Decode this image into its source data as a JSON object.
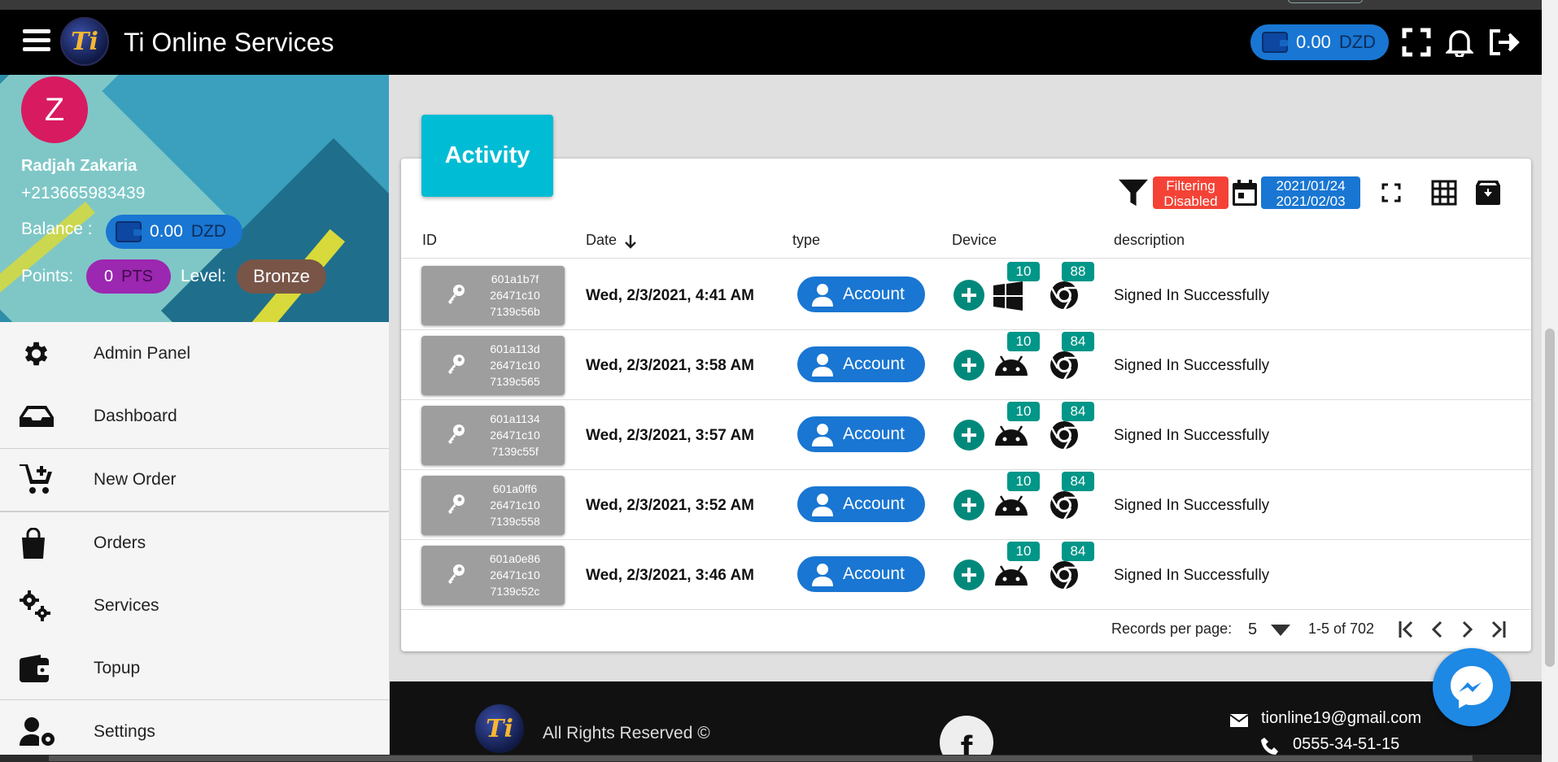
{
  "appbar": {
    "title": "Ti Online Services",
    "logo_text": "Ti",
    "wallet_amount": "0.00",
    "wallet_currency": "DZD"
  },
  "profile": {
    "avatar_letter": "Z",
    "name": "Radjah Zakaria",
    "phone": "+213665983439",
    "balance_label": "Balance :",
    "balance_amount": "0.00",
    "balance_currency": "DZD",
    "points_label": "Points:",
    "points_value": "0",
    "points_unit": "PTS",
    "level_label": "Level:",
    "level_value": "Bronze"
  },
  "sidebar": {
    "items": [
      {
        "label": "Admin Panel",
        "icon": "gear-icon"
      },
      {
        "label": "Dashboard",
        "icon": "inbox-icon"
      },
      {
        "label": "New Order",
        "icon": "cart-plus-icon"
      },
      {
        "label": "Orders",
        "icon": "shopping-bag-icon"
      },
      {
        "label": "Services",
        "icon": "gears-icon"
      },
      {
        "label": "Topup",
        "icon": "wallet-icon"
      },
      {
        "label": "Settings",
        "icon": "user-cog-icon"
      }
    ]
  },
  "activity": {
    "title": "Activity",
    "filter_chip_line1": "Filtering",
    "filter_chip_line2": "Disabled",
    "date_from": "2021/01/24",
    "date_to": "2021/02/03",
    "columns": {
      "id": "ID",
      "date": "Date",
      "type": "type",
      "device": "Device",
      "description": "description"
    },
    "rows": [
      {
        "id1": "601a1b7f",
        "id2": "26471c10",
        "id3": "7139c56b",
        "date": "Wed, 2/3/2021, 4:41 AM",
        "type": "Account",
        "os": "windows-icon",
        "os_version": "10",
        "browser_version": "88",
        "description": "Signed In Successfully"
      },
      {
        "id1": "601a113d",
        "id2": "26471c10",
        "id3": "7139c565",
        "date": "Wed, 2/3/2021, 3:58 AM",
        "type": "Account",
        "os": "android-icon",
        "os_version": "10",
        "browser_version": "84",
        "description": "Signed In Successfully"
      },
      {
        "id1": "601a1134",
        "id2": "26471c10",
        "id3": "7139c55f",
        "date": "Wed, 2/3/2021, 3:57 AM",
        "type": "Account",
        "os": "android-icon",
        "os_version": "10",
        "browser_version": "84",
        "description": "Signed In Successfully"
      },
      {
        "id1": "601a0ff6",
        "id2": "26471c10",
        "id3": "7139c558",
        "date": "Wed, 2/3/2021, 3:52 AM",
        "type": "Account",
        "os": "android-icon",
        "os_version": "10",
        "browser_version": "84",
        "description": "Signed In Successfully"
      },
      {
        "id1": "601a0e86",
        "id2": "26471c10",
        "id3": "7139c52c",
        "date": "Wed, 2/3/2021, 3:46 AM",
        "type": "Account",
        "os": "android-icon",
        "os_version": "10",
        "browser_version": "84",
        "description": "Signed In Successfully"
      }
    ],
    "pager": {
      "label": "Records per page:",
      "per_page": "5",
      "range": "1-5 of 702"
    }
  },
  "footer": {
    "rights": "All Rights Reserved ©",
    "email": "tionline19@gmail.com",
    "phone": "0555-34-51-15",
    "facebook_letter": "f"
  },
  "colors": {
    "primary": "#1976d2",
    "accent_cyan": "#00bcd4",
    "teal_badge": "#009688",
    "red_chip": "#f44336",
    "avatar": "#d81b60",
    "points": "#9c27b0",
    "level": "#795548"
  }
}
